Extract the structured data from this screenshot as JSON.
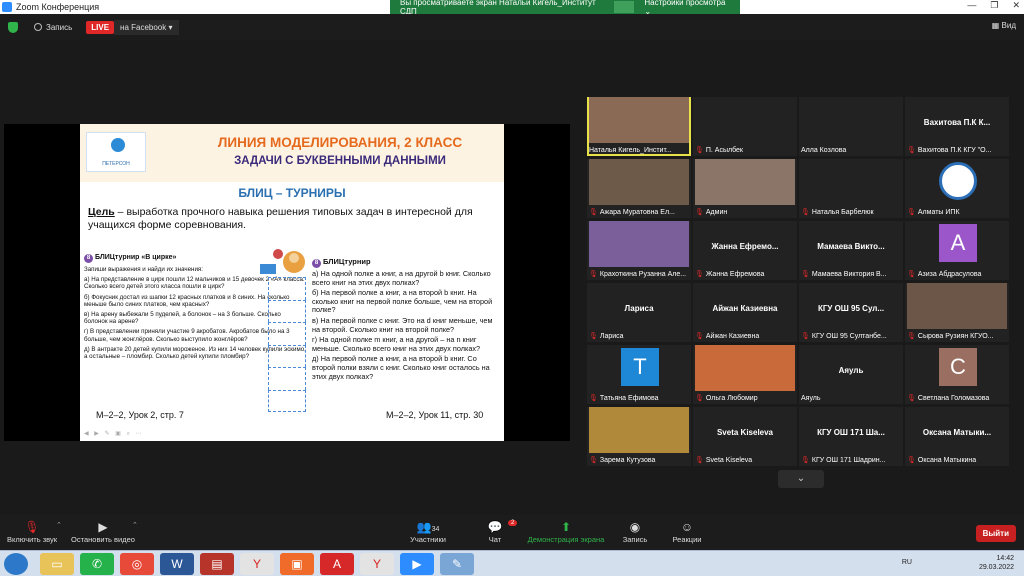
{
  "window": {
    "title": "Zoom Конференция"
  },
  "banner": {
    "text": "Вы просматриваете экран Натальи Кигель_Институт СДП",
    "options": "Настройки просмотра ⌄"
  },
  "meeting_bar": {
    "record": "Запись",
    "live": "LIVE",
    "live_target": "на Facebook",
    "view": "Вид"
  },
  "slide": {
    "logo": "ПЕТЕРСОН",
    "title": "ЛИНИЯ МОДЕЛИРОВАНИЯ,  2 КЛАСС",
    "subtitle": "ЗАДАЧИ С БУКВЕННЫМИ ДАННЫМИ",
    "heading": "БЛИЦ – ТУРНИРЫ",
    "goal_label": "Цель",
    "goal_text": " – выработка прочного навыка решения типовых задач в интересной для учащихся форме соревнования.",
    "left_title": "БЛИЦтурнир «В цирке»",
    "left_intro": "Запиши выражения и найди их значения:",
    "left_items": [
      "а) На представление в цирк пошли 12 мальчиков и 15 девочек 2 «А» класса. Сколько всего детей этого класса пошли в цирк?",
      "б) Фокусник достал из шапки 12 красных платков и 8 синих. На сколько меньше было синих платков, чем красных?",
      "в) На арену выбежали 5 пуделей, а болонок – на 3 больше. Сколько болонок на арене?",
      "г) В представлении приняли участие 9 акробатов. Акробатов было на 3 больше, чем жонглёров. Сколько выступило жонглёров?",
      "д) В антракте 20 детей купили мороженое. Из них 14 человек купили эскимо, а остальные – пломбир. Сколько детей купили пломбир?"
    ],
    "right_title": "БЛИЦтурнир",
    "right_items": [
      "а) На одной полке а книг, а на другой b книг. Сколько всего книг на этих двух полках?",
      "б) На первой полке а книг, а на второй b книг. На сколько книг на первой полке больше, чем на второй полке?",
      "в) На первой полке с книг. Это на d книг меньше, чем на второй. Сколько книг на второй полке?",
      "г) На одной полке m книг, а на другой – на n книг меньше. Сколько всего книг на этих двух полках?",
      "д) На первой полке а книг, а на второй b книг. Со второй полки взяли с книг. Сколько книг осталось на этих двух полках?"
    ],
    "ref_left": "М–2–2, Урок 2, стр. 7",
    "ref_right": "М–2–2, Урок 11, стр. 30",
    "badge": "8"
  },
  "participants": [
    {
      "name": "Наталья Кигель_Инстит...",
      "overlay": "",
      "muted": false,
      "kind": "video",
      "color": "#8a6a55",
      "active": true
    },
    {
      "name": "П. Асылбек",
      "overlay": "",
      "muted": true,
      "kind": "blank"
    },
    {
      "name": "Алла Козлова",
      "overlay": "",
      "muted": false,
      "kind": "blank"
    },
    {
      "name": "Вахитова П.К КГУ \"О...",
      "overlay": "Вахитова П.К К...",
      "muted": true,
      "kind": "text"
    },
    {
      "name": "Ажара Муратовна Ел...",
      "overlay": "",
      "muted": true,
      "kind": "video",
      "color": "#6d5a48"
    },
    {
      "name": "Админ",
      "overlay": "",
      "muted": true,
      "kind": "video",
      "color": "#8b7468"
    },
    {
      "name": "Наталья Барбелюк",
      "overlay": "",
      "muted": true,
      "kind": "blank"
    },
    {
      "name": "Алматы ИПК",
      "overlay": "",
      "muted": true,
      "kind": "logo",
      "color": "#2c6fb7"
    },
    {
      "name": "Крахоткина Рузанна Але...",
      "overlay": "",
      "muted": true,
      "kind": "video",
      "color": "#7a5f9a"
    },
    {
      "name": "Жанна Ефремова",
      "overlay": "Жанна Ефремо...",
      "muted": true,
      "kind": "text"
    },
    {
      "name": "Мамаева Виктория В...",
      "overlay": "Мамаева Викто...",
      "muted": true,
      "kind": "text"
    },
    {
      "name": "Азиза Абдрасулова",
      "overlay": "",
      "muted": true,
      "kind": "avatar",
      "letter": "A",
      "color": "#9b57c9"
    },
    {
      "name": "Лариса",
      "overlay": "Лариса",
      "muted": true,
      "kind": "text"
    },
    {
      "name": "Айжан Казиевна",
      "overlay": "Айжан Казиевна",
      "muted": true,
      "kind": "text"
    },
    {
      "name": "КГУ ОШ 95 Султанбе...",
      "overlay": "КГУ ОШ 95 Сул...",
      "muted": true,
      "kind": "text"
    },
    {
      "name": "Сырова Рузиян КГУО...",
      "overlay": "",
      "muted": true,
      "kind": "video",
      "color": "#6b5648"
    },
    {
      "name": "Татьяна Ефимова",
      "overlay": "",
      "muted": true,
      "kind": "avatar",
      "letter": "T",
      "color": "#1e88d6"
    },
    {
      "name": "Ольга Любомир",
      "overlay": "",
      "muted": true,
      "kind": "video",
      "color": "#c96a3a"
    },
    {
      "name": "Аяуль",
      "overlay": "Аяуль",
      "muted": false,
      "kind": "text"
    },
    {
      "name": "Светлана Голомазова",
      "overlay": "",
      "muted": true,
      "kind": "avatar",
      "letter": "C",
      "color": "#9a6f62"
    },
    {
      "name": "Зарема Кутузова",
      "overlay": "",
      "muted": true,
      "kind": "video",
      "color": "#b08a3a"
    },
    {
      "name": "Sveta Kiseleva",
      "overlay": "Sveta Kiseleva",
      "muted": true,
      "kind": "text"
    },
    {
      "name": "КГУ ОШ 171 Шадрин...",
      "overlay": "КГУ ОШ 171 Ша...",
      "muted": true,
      "kind": "text"
    },
    {
      "name": "Оксана Матыкина",
      "overlay": "Оксана Матыки...",
      "muted": true,
      "kind": "text"
    }
  ],
  "toolbar": {
    "mute": "Включить звук",
    "video": "Остановить видео",
    "participants": "Участники",
    "participants_count": "34",
    "chat": "Чат",
    "chat_badge": "2",
    "share": "Демонстрация экрана",
    "record": "Запись",
    "reactions": "Реакции",
    "leave": "Выйти"
  },
  "taskbar": {
    "lang": "RU",
    "time": "14:42",
    "date": "29.03.2022"
  }
}
